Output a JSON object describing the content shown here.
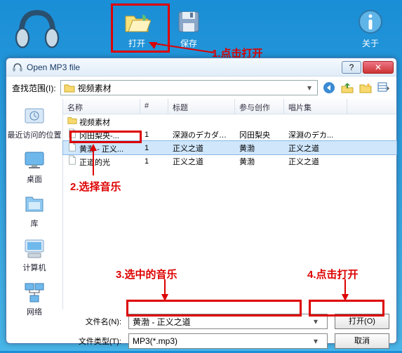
{
  "host": {
    "open": "打开",
    "save": "保存",
    "about": "关于"
  },
  "annot": {
    "a1": "1.点击打开",
    "a2": "2.选择音乐",
    "a3": "3.选中的音乐",
    "a4": "4.点击打开"
  },
  "dialog": {
    "title": "Open MP3 file",
    "lookin_label": "查找范围(I):",
    "lookin_value": "视频素材",
    "cols": {
      "name": "名称",
      "num": "#",
      "title": "标题",
      "ppl": "参与创作的...",
      "album": "唱片集"
    },
    "rows": [
      {
        "kind": "folder",
        "name": "视频素材"
      },
      {
        "kind": "file",
        "name": "冈田梨央-...",
        "num": "1",
        "title": "深淵のデカダン...",
        "ppl": "冈田梨央",
        "album": "深淵のデカ..."
      },
      {
        "kind": "file",
        "name": "黄渤 - 正义...",
        "num": "1",
        "title": "正义之道",
        "ppl": "黄渤",
        "album": "正义之道",
        "selected": true
      },
      {
        "kind": "file",
        "name": "正道的光",
        "num": "1",
        "title": "正义之道",
        "ppl": "黄渤",
        "album": "正义之道"
      }
    ],
    "filename_label": "文件名(N):",
    "filename_value": "黄渤 - 正义之道",
    "filetype_label": "文件类型(T):",
    "filetype_value": "MP3(*.mp3)",
    "open_btn": "打开(O)",
    "cancel_btn": "取消"
  },
  "sidebar": {
    "recent": "最近访问的位置",
    "desktop": "桌面",
    "library": "库",
    "computer": "计算机",
    "network": "网络"
  }
}
